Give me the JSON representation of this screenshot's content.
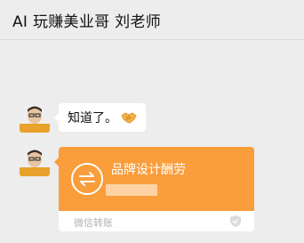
{
  "header": {
    "title": "AI 玩赚美业哥 刘老师"
  },
  "messages": [
    {
      "type": "text",
      "text": "知道了。",
      "emoji": "handshake"
    },
    {
      "type": "transfer",
      "title": "品牌设计酬劳",
      "footer": "微信转账"
    }
  ],
  "colors": {
    "background": "#ededed",
    "bubble": "#ffffff",
    "transfer_orange": "#fa9d3b"
  }
}
